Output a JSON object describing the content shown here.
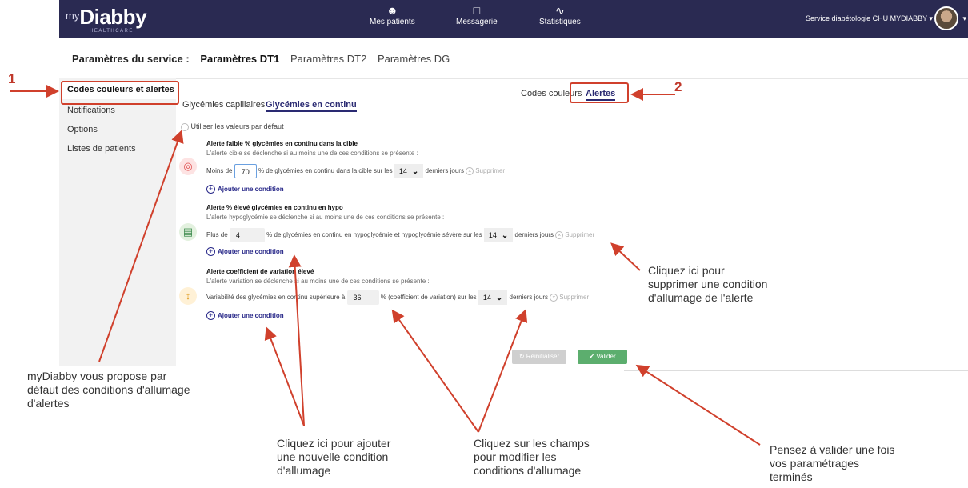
{
  "navbar": {
    "logo_prefix": "my",
    "logo_name": "Diabby",
    "logo_sub": "HEALTHCARE",
    "items": [
      {
        "label": "Mes patients",
        "icon": "users-icon"
      },
      {
        "label": "Messagerie",
        "icon": "chat-icon"
      },
      {
        "label": "Statistiques",
        "icon": "chart-icon"
      }
    ],
    "user_label": "Service diabétologie CHU MYDIABBY"
  },
  "service": {
    "label": "Paramètres du service :",
    "tabs": [
      "Paramètres DT1",
      "Paramètres DT2",
      "Paramètres DG"
    ],
    "active_tab": "Paramètres DT1"
  },
  "sidebar": {
    "items": [
      "Codes couleurs et alertes",
      "Notifications",
      "Options",
      "Listes de patients"
    ],
    "active": "Codes couleurs et alertes"
  },
  "content": {
    "top_tabs": [
      "Codes couleurs",
      "Alertes"
    ],
    "sub_tabs": [
      "Glycémies capillaires",
      "Glycémies en continu"
    ],
    "default_option": "Utiliser les valeurs par défaut",
    "alerts": [
      {
        "title": "Alerte faible % glycémies en continu dans la cible",
        "desc": "L'alerte cible se déclenche si au moins une de ces conditions se présente :",
        "prefix": "Moins de",
        "value": "70",
        "middle": "% de glycémies en continu dans la cible sur les",
        "days": "14",
        "suffix": "derniers jours"
      },
      {
        "title": "Alerte % élevé glycémies en continu en hypo",
        "desc": "L'alerte hypoglycémie se déclenche si au moins une de ces conditions se présente :",
        "prefix": "Plus de",
        "value": "4",
        "middle": "% de glycémies en continu en hypoglycémie et hypoglycémie sévère sur les",
        "days": "14",
        "suffix": "derniers jours"
      },
      {
        "title": "Alerte coefficient de variation élevé",
        "desc": "L'alerte variation se déclenche si au moins une de ces conditions se présente :",
        "prefix": "Variabilité des glycémies en continu supérieure à",
        "value": "36",
        "middle": "% (coefficient de variation) sur les",
        "days": "14",
        "suffix": "derniers jours"
      }
    ],
    "delete_label": "Supprimer",
    "add_label": "Ajouter une condition",
    "reset_label": "Réinitialiser",
    "validate_label": "Valider"
  },
  "callouts": {
    "n1": "1",
    "n2": "2",
    "delete_note": [
      "Cliquez ici pour",
      "supprimer une condition",
      "d'allumage de l'alerte"
    ],
    "default_note": [
      "myDiabby vous propose par",
      "défaut des conditions d'allumage",
      "d'alertes"
    ],
    "add_note": [
      "Cliquez ici pour ajouter",
      "une nouvelle condition",
      "d'allumage"
    ],
    "fields_note": [
      "Cliquez sur les champs",
      "pour modifier les",
      "conditions d'allumage"
    ],
    "validate_note": [
      "Pensez à valider une fois",
      "vos paramétrages",
      "terminés"
    ]
  },
  "colors": {
    "navbar": "#2a2a52",
    "accent": "#2a2a8a",
    "callout_red": "#c0392b",
    "validate_green": "#5cae6e"
  }
}
